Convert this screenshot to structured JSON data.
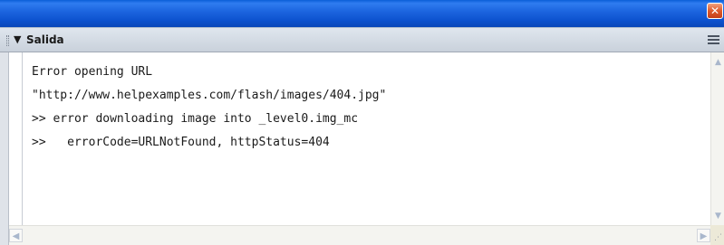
{
  "window": {
    "close_glyph": "✕"
  },
  "panel": {
    "title": "Salida",
    "collapse_glyph": "▼"
  },
  "output": {
    "lines": [
      "Error opening URL",
      "\"http://www.helpexamples.com/flash/images/404.jpg\"",
      ">> error downloading image into _level0.img_mc",
      ">>   errorCode=URLNotFound, httpStatus=404"
    ]
  },
  "scrollbars": {
    "up_glyph": "▲",
    "down_glyph": "▼",
    "left_glyph": "◀",
    "right_glyph": "▶"
  },
  "colors": {
    "titlebar": "#0d52cf",
    "panel_header": "#c9d1db",
    "close_button": "#de5a2c",
    "output_bg": "#ffffff"
  }
}
